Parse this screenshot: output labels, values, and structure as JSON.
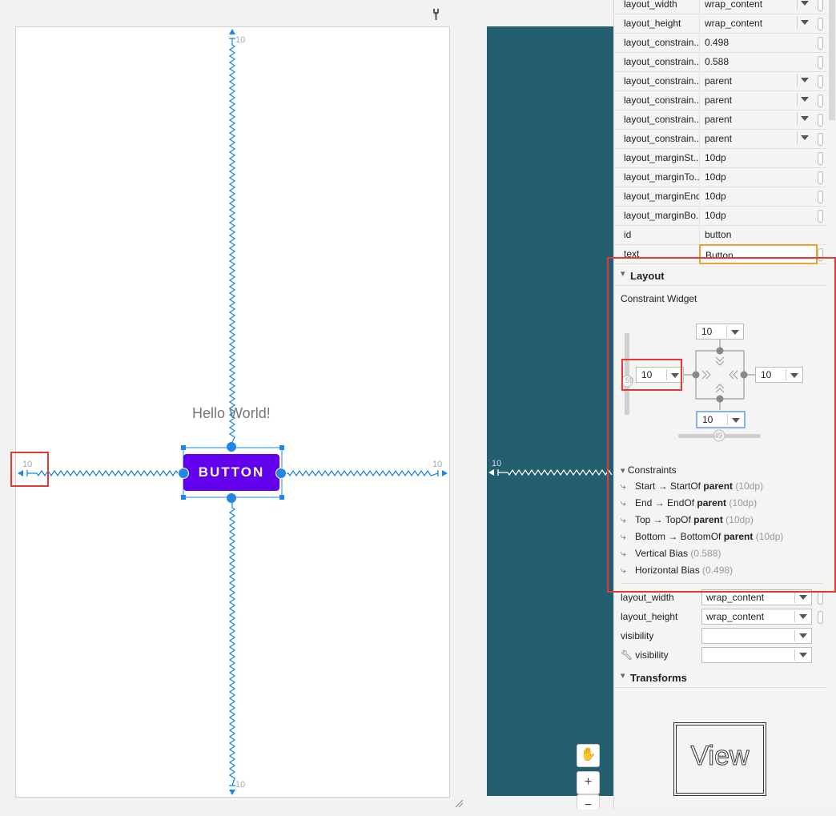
{
  "canvas": {
    "hello_text": "Hello World!",
    "button_text": "BUTTON",
    "margin_top": "10",
    "margin_bottom": "10",
    "margin_left": "10",
    "margin_right": "10",
    "blueprint_margin": "10"
  },
  "attributes": [
    {
      "name": "layout_width",
      "value": "wrap_content",
      "dropdown": true
    },
    {
      "name": "layout_height",
      "value": "wrap_content",
      "dropdown": true
    },
    {
      "name": "layout_constrain...",
      "value": "0.498",
      "dropdown": false
    },
    {
      "name": "layout_constrain...",
      "value": "0.588",
      "dropdown": false
    },
    {
      "name": "layout_constrain...",
      "value": "parent",
      "dropdown": true
    },
    {
      "name": "layout_constrain...",
      "value": "parent",
      "dropdown": true
    },
    {
      "name": "layout_constrain...",
      "value": "parent",
      "dropdown": true
    },
    {
      "name": "layout_constrain...",
      "value": "parent",
      "dropdown": true
    },
    {
      "name": "layout_marginSt...",
      "value": "10dp",
      "dropdown": false
    },
    {
      "name": "layout_marginTo...",
      "value": "10dp",
      "dropdown": false
    },
    {
      "name": "layout_marginEnd",
      "value": "10dp",
      "dropdown": false
    },
    {
      "name": "layout_marginBo...",
      "value": "10dp",
      "dropdown": false
    },
    {
      "name": "id",
      "value": "button",
      "dropdown": false
    },
    {
      "name": "text",
      "value": "Button",
      "dropdown": false
    }
  ],
  "layout_section": {
    "title": "Layout",
    "widget_title": "Constraint Widget",
    "top_margin": "10",
    "left_margin": "10",
    "right_margin": "10",
    "bottom_margin": "10",
    "vertical_bias_label": "59",
    "horizontal_bias_label": "49",
    "constraints_title": "Constraints",
    "constraints": [
      {
        "pre": "Start → StartOf ",
        "target": "parent",
        "post": " (10dp)"
      },
      {
        "pre": "End → EndOf ",
        "target": "parent",
        "post": " (10dp)"
      },
      {
        "pre": "Top → TopOf ",
        "target": "parent",
        "post": " (10dp)"
      },
      {
        "pre": "Bottom → BottomOf ",
        "target": "parent",
        "post": " (10dp)"
      },
      {
        "pre": "Vertical Bias ",
        "target": "",
        "post": " (0.588)"
      },
      {
        "pre": "Horizontal Bias ",
        "target": "",
        "post": " (0.498)"
      }
    ]
  },
  "layout_props": [
    {
      "name": "layout_width",
      "value": "wrap_content"
    },
    {
      "name": "layout_height",
      "value": "wrap_content"
    },
    {
      "name": "visibility",
      "value": ""
    },
    {
      "name": "visibility",
      "value": ""
    }
  ],
  "transforms": {
    "title": "Transforms",
    "preview_text": "View"
  },
  "zoom": {
    "pan_icon": "hand-icon",
    "zoom_in": "+",
    "zoom_out": "−"
  },
  "colors": {
    "button": "#6200ee",
    "constraint": "#1e88e5",
    "blueprint": "#235f6e",
    "highlight": "#e53935",
    "focus": "#f0a030"
  }
}
